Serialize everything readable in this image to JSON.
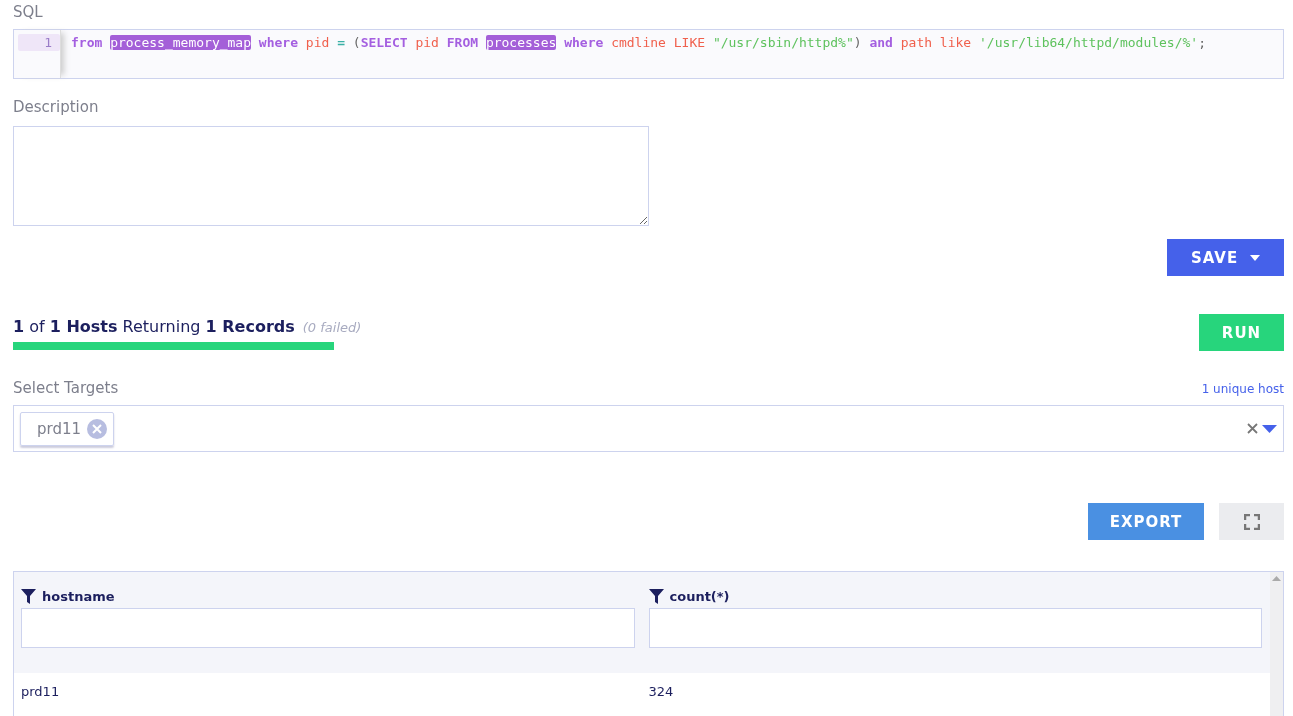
{
  "sql": {
    "label": "SQL",
    "line_number": "1",
    "tokens": [
      {
        "text": "from ",
        "kind": "keyword"
      },
      {
        "text": "process_memory_map",
        "kind": "table"
      },
      {
        "text": " where ",
        "kind": "keyword"
      },
      {
        "text": "pid ",
        "kind": "identifier"
      },
      {
        "text": "= ",
        "kind": "operator"
      },
      {
        "text": "(",
        "kind": "punctuation"
      },
      {
        "text": "SELECT ",
        "kind": "keyword"
      },
      {
        "text": "pid ",
        "kind": "identifier"
      },
      {
        "text": "FROM ",
        "kind": "keyword"
      },
      {
        "text": "processes",
        "kind": "table"
      },
      {
        "text": " where ",
        "kind": "keyword"
      },
      {
        "text": "cmdline LIKE ",
        "kind": "identifier"
      },
      {
        "text": "\"/usr/sbin/httpd%\"",
        "kind": "string"
      },
      {
        "text": ") ",
        "kind": "punctuation"
      },
      {
        "text": "and ",
        "kind": "keyword"
      },
      {
        "text": "path like ",
        "kind": "identifier"
      },
      {
        "text": "'/usr/lib64/httpd/modules/%'",
        "kind": "string"
      },
      {
        "text": ";",
        "kind": "punctuation"
      }
    ]
  },
  "description": {
    "label": "Description"
  },
  "save_button": "SAVE",
  "status": {
    "text": "**1** of **1 Hosts** Returning **1 Records**",
    "failed": "(0 failed)",
    "level": 1
  },
  "run_button": "RUN",
  "targets": {
    "label": "Select Targets",
    "summary": "1 unique host",
    "chips": [
      "prd11"
    ]
  },
  "export_button": "EXPORT",
  "table": {
    "columns": [
      "hostname",
      "count(*)"
    ],
    "rows": [
      [
        "prd11",
        "324"
      ]
    ]
  }
}
